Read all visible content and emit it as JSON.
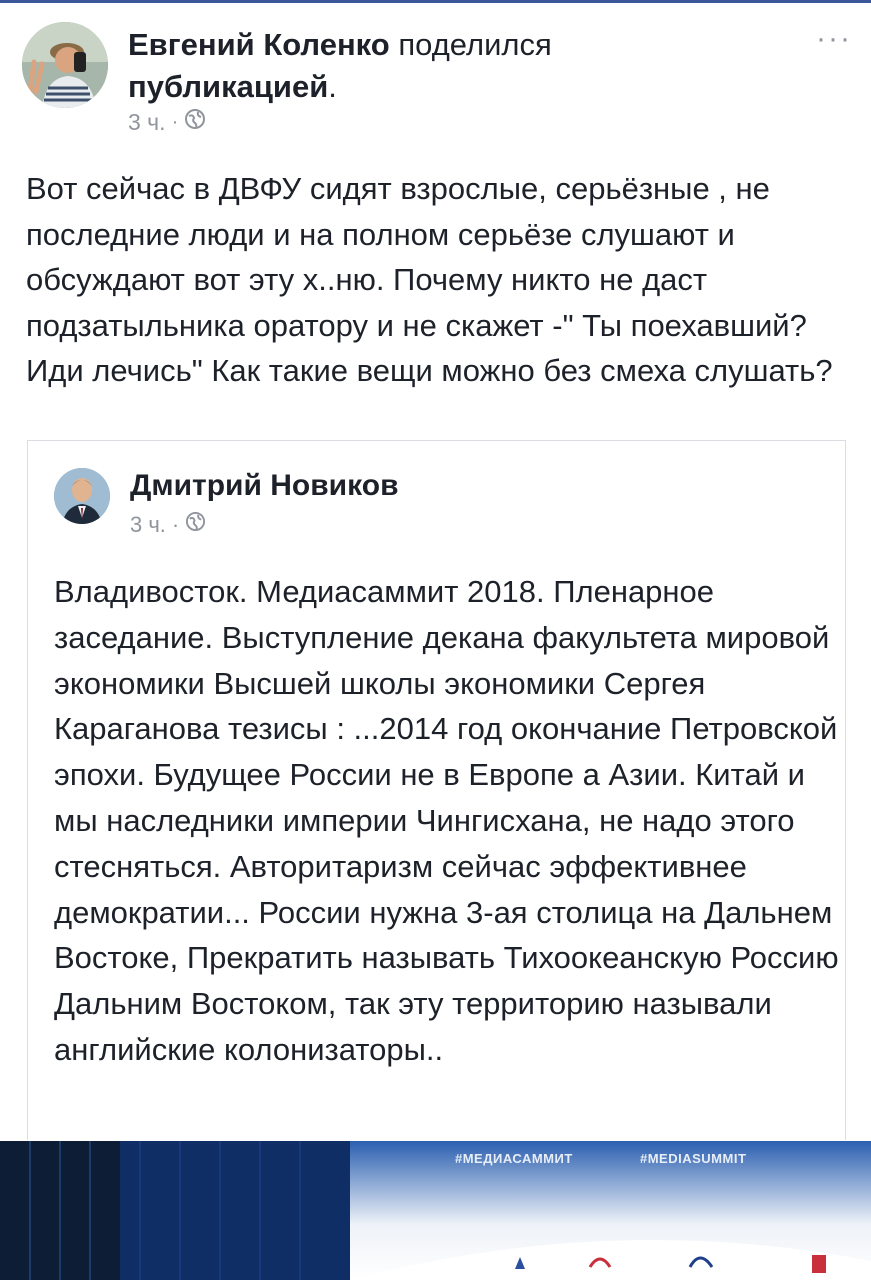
{
  "post": {
    "author": "Евгений Коленко",
    "action": "поделился",
    "action_link": "публикацией",
    "period": ".",
    "time": "3 ч.",
    "dot": "·",
    "more_label": "···",
    "text": "Вот сейчас в ДВФУ сидят взрослые, серьёзные , не последние люди и на полном серьёзе слушают и обсуждают вот эту х..ню. Почему никто не даст подзатыльника оратору и не скажет -\" Ты поехавший? Иди лечись\" Как такие вещи можно без смеха слушать?"
  },
  "shared": {
    "author": "Дмитрий Новиков",
    "time": "3 ч.",
    "dot": "·",
    "text": "Владивосток. Медиасаммит 2018.  Пленарное заседание. Выступление декана факультета мировой экономики Высшей школы экономики Сергея Караганова тезисы : ...2014 год окончание Петровской эпохи. Будущее России не в Европе а Азии. Китай и мы наследники империи Чингисхана, не надо этого стесняться. Авторитаризм сейчас эффективнее демократии... России нужна 3-ая столица на Дальнем Востоке, Прекратить называть Тихоокеанскую Россию Дальним Востоком, так эту территорию называли английские колонизаторы.."
  },
  "media": {
    "tag_ru": "#МЕДИАСАММИТ",
    "tag_en": "#MEDIASUMMIT"
  },
  "icons": {
    "privacy": "globe-icon",
    "more": "more-dots-icon"
  },
  "colors": {
    "text": "#1d2129",
    "meta": "#90949c",
    "border": "#dadde1",
    "stage_blue": "#0d2a63"
  }
}
